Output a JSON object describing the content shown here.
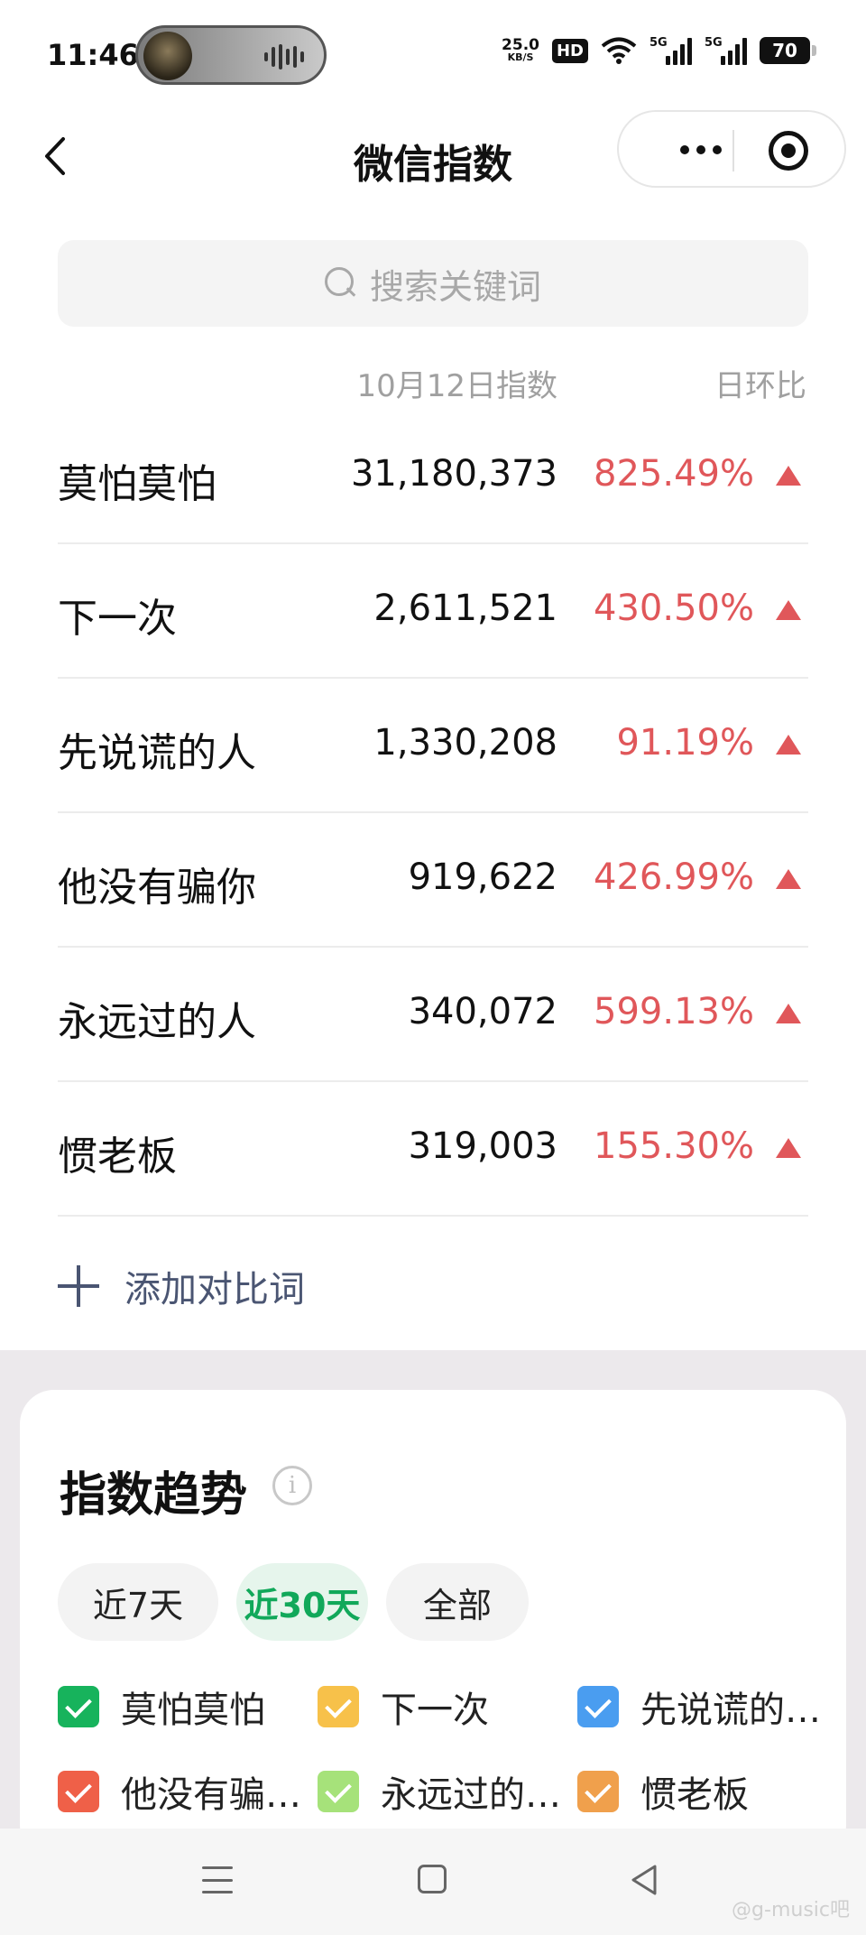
{
  "status_bar": {
    "time": "11:46",
    "net_speed": "25.0",
    "net_unit": "KB/S",
    "hd": "HD",
    "sig1": "5G",
    "sig2": "5G",
    "battery": "70"
  },
  "nav": {
    "title": "微信指数"
  },
  "search": {
    "placeholder": "搜索关键词"
  },
  "table": {
    "header_index": "10月12日指数",
    "header_ratio": "日环比",
    "rows": [
      {
        "name": "莫怕莫怕",
        "value": "31,180,373",
        "ratio": "825.49%"
      },
      {
        "name": "下一次",
        "value": "2,611,521",
        "ratio": "430.50%"
      },
      {
        "name": "先说谎的人",
        "value": "1,330,208",
        "ratio": "91.19%"
      },
      {
        "name": "他没有骗你",
        "value": "919,622",
        "ratio": "426.99%"
      },
      {
        "name": "永远过的人",
        "value": "340,072",
        "ratio": "599.13%"
      },
      {
        "name": "惯老板",
        "value": "319,003",
        "ratio": "155.30%"
      }
    ],
    "up_color": "#e0575a"
  },
  "add_compare": {
    "label": "添加对比词"
  },
  "trend": {
    "title": "指数趋势",
    "info": "i",
    "tabs": [
      {
        "label": "近7天",
        "active": false
      },
      {
        "label": "近30天",
        "active": true
      },
      {
        "label": "全部",
        "active": false
      }
    ],
    "legend": [
      {
        "label": "莫怕莫怕",
        "color": "#17b35c"
      },
      {
        "label": "下一次",
        "color": "#f7c14a"
      },
      {
        "label": "先说谎的…",
        "color": "#4a9df0"
      },
      {
        "label": "他没有骗…",
        "color": "#ef6048"
      },
      {
        "label": "永远过的…",
        "color": "#a6e27a"
      },
      {
        "label": "惯老板",
        "color": "#f0a04c"
      }
    ]
  },
  "watermark": "@g-music吧"
}
